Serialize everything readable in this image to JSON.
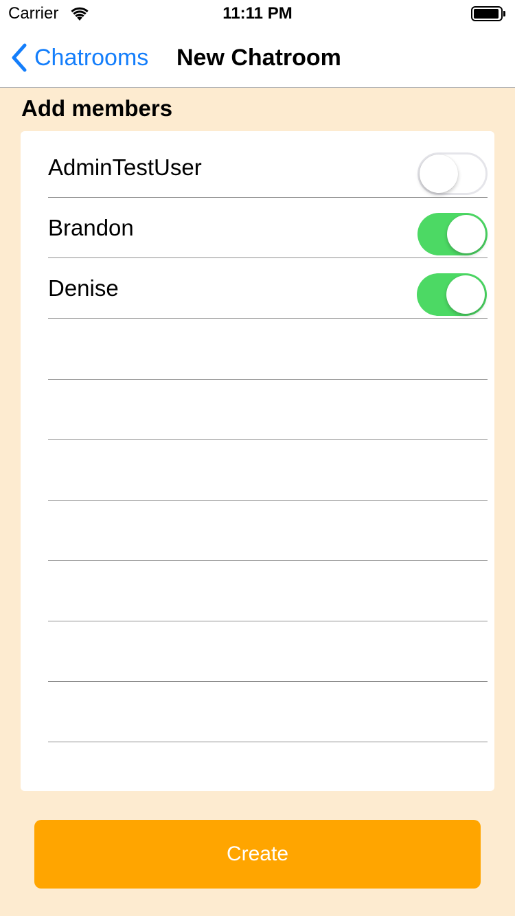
{
  "status_bar": {
    "carrier": "Carrier",
    "time": "11:11 PM",
    "wifi_icon": "wifi-icon",
    "battery_icon": "battery-icon"
  },
  "nav": {
    "back_label": "Chatrooms",
    "back_icon": "chevron-left-icon",
    "title": "New Chatroom"
  },
  "section": {
    "heading": "Add members"
  },
  "members": [
    {
      "name": "AdminTestUser",
      "selected": false
    },
    {
      "name": "Brandon",
      "selected": true
    },
    {
      "name": "Denise",
      "selected": true
    }
  ],
  "create_button": {
    "label": "Create"
  },
  "colors": {
    "background": "#FDEBD0",
    "accent_blue": "#147EFB",
    "switch_on": "#4CD964",
    "button": "#FFA500"
  }
}
